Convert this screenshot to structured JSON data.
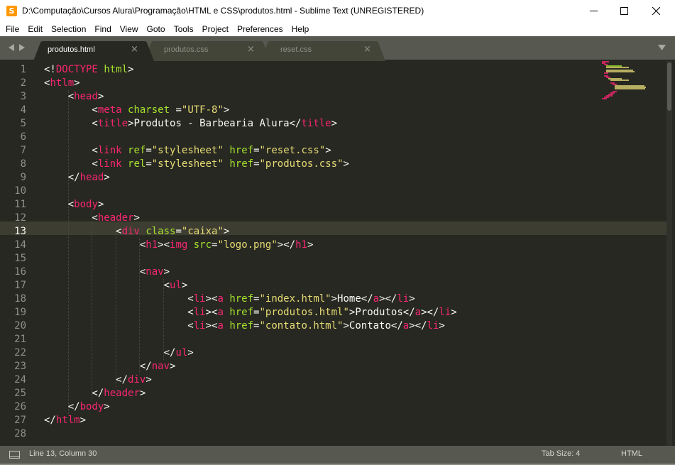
{
  "window": {
    "title": "D:\\Computação\\Cursos Alura\\Programação\\HTML e CSS\\produtos.html - Sublime Text (UNREGISTERED)",
    "app_icon_letter": "S"
  },
  "menu": [
    "File",
    "Edit",
    "Selection",
    "Find",
    "View",
    "Goto",
    "Tools",
    "Project",
    "Preferences",
    "Help"
  ],
  "tabs": [
    {
      "label": "produtos.html",
      "active": true
    },
    {
      "label": "produtos.css",
      "active": false
    },
    {
      "label": "reset.css",
      "active": false
    }
  ],
  "editor": {
    "current_line": 13,
    "line_numbers": [
      "1",
      "2",
      "3",
      "4",
      "5",
      "6",
      "7",
      "8",
      "9",
      "10",
      "11",
      "12",
      "13",
      "14",
      "15",
      "16",
      "17",
      "18",
      "19",
      "20",
      "21",
      "22",
      "23",
      "24",
      "25",
      "26",
      "27",
      "28"
    ],
    "lines": [
      [
        [
          "t",
          "<!"
        ],
        [
          "k",
          "DOCTYPE"
        ],
        [
          "t",
          " "
        ],
        [
          "a",
          "html"
        ],
        [
          "t",
          ">"
        ]
      ],
      [
        [
          "t",
          "<"
        ],
        [
          "k",
          "htlm"
        ],
        [
          "t",
          ">"
        ]
      ],
      [
        [
          "t",
          "    <"
        ],
        [
          "k",
          "head"
        ],
        [
          "t",
          ">"
        ]
      ],
      [
        [
          "t",
          "        <"
        ],
        [
          "k",
          "meta"
        ],
        [
          "t",
          " "
        ],
        [
          "a",
          "charset"
        ],
        [
          "t",
          " ="
        ],
        [
          "s",
          "\"UTF-8\""
        ],
        [
          "t",
          ">"
        ]
      ],
      [
        [
          "t",
          "        <"
        ],
        [
          "k",
          "title"
        ],
        [
          "t",
          ">Produtos - Barbearia Alura</"
        ],
        [
          "k",
          "title"
        ],
        [
          "t",
          ">"
        ]
      ],
      [],
      [
        [
          "t",
          "        <"
        ],
        [
          "k",
          "link"
        ],
        [
          "t",
          " "
        ],
        [
          "a",
          "ref"
        ],
        [
          "t",
          "="
        ],
        [
          "s",
          "\"stylesheet\""
        ],
        [
          "t",
          " "
        ],
        [
          "a",
          "href"
        ],
        [
          "t",
          "="
        ],
        [
          "s",
          "\"reset.css\""
        ],
        [
          "t",
          ">"
        ]
      ],
      [
        [
          "t",
          "        <"
        ],
        [
          "k",
          "link"
        ],
        [
          "t",
          " "
        ],
        [
          "a",
          "rel"
        ],
        [
          "t",
          "="
        ],
        [
          "s",
          "\"stylesheet\""
        ],
        [
          "t",
          " "
        ],
        [
          "a",
          "href"
        ],
        [
          "t",
          "="
        ],
        [
          "s",
          "\"produtos.css\""
        ],
        [
          "t",
          ">"
        ]
      ],
      [
        [
          "t",
          "    </"
        ],
        [
          "k",
          "head"
        ],
        [
          "t",
          ">"
        ]
      ],
      [],
      [
        [
          "t",
          "    <"
        ],
        [
          "k",
          "body"
        ],
        [
          "t",
          ">"
        ]
      ],
      [
        [
          "t",
          "        <"
        ],
        [
          "k",
          "header"
        ],
        [
          "t",
          ">"
        ]
      ],
      [
        [
          "t",
          "            <"
        ],
        [
          "k",
          "div"
        ],
        [
          "t",
          " "
        ],
        [
          "a",
          "class"
        ],
        [
          "t",
          "="
        ],
        [
          "s",
          "\"caixa\""
        ],
        [
          "t",
          ">"
        ]
      ],
      [
        [
          "t",
          "                <"
        ],
        [
          "k",
          "h1"
        ],
        [
          "t",
          "><"
        ],
        [
          "k",
          "img"
        ],
        [
          "t",
          " "
        ],
        [
          "a",
          "src"
        ],
        [
          "t",
          "="
        ],
        [
          "s",
          "\"logo.png\""
        ],
        [
          "t",
          "></"
        ],
        [
          "k",
          "h1"
        ],
        [
          "t",
          ">"
        ]
      ],
      [],
      [
        [
          "t",
          "                <"
        ],
        [
          "k",
          "nav"
        ],
        [
          "t",
          ">"
        ]
      ],
      [
        [
          "t",
          "                    <"
        ],
        [
          "k",
          "ul"
        ],
        [
          "t",
          ">"
        ]
      ],
      [
        [
          "t",
          "                        <"
        ],
        [
          "k",
          "li"
        ],
        [
          "t",
          "><"
        ],
        [
          "k",
          "a"
        ],
        [
          "t",
          " "
        ],
        [
          "a",
          "href"
        ],
        [
          "t",
          "="
        ],
        [
          "s",
          "\"index.html\""
        ],
        [
          "t",
          ">Home</"
        ],
        [
          "k",
          "a"
        ],
        [
          "t",
          "></"
        ],
        [
          "k",
          "li"
        ],
        [
          "t",
          ">"
        ]
      ],
      [
        [
          "t",
          "                        <"
        ],
        [
          "k",
          "li"
        ],
        [
          "t",
          "><"
        ],
        [
          "k",
          "a"
        ],
        [
          "t",
          " "
        ],
        [
          "a",
          "href"
        ],
        [
          "t",
          "="
        ],
        [
          "s",
          "\"produtos.html\""
        ],
        [
          "t",
          ">Produtos</"
        ],
        [
          "k",
          "a"
        ],
        [
          "t",
          "></"
        ],
        [
          "k",
          "li"
        ],
        [
          "t",
          ">"
        ]
      ],
      [
        [
          "t",
          "                        <"
        ],
        [
          "k",
          "li"
        ],
        [
          "t",
          "><"
        ],
        [
          "k",
          "a"
        ],
        [
          "t",
          " "
        ],
        [
          "a",
          "href"
        ],
        [
          "t",
          "="
        ],
        [
          "s",
          "\"contato.html\""
        ],
        [
          "t",
          ">Contato</"
        ],
        [
          "k",
          "a"
        ],
        [
          "t",
          "></"
        ],
        [
          "k",
          "li"
        ],
        [
          "t",
          ">"
        ]
      ],
      [],
      [
        [
          "t",
          "                    </"
        ],
        [
          "k",
          "ul"
        ],
        [
          "t",
          ">"
        ]
      ],
      [
        [
          "t",
          "                </"
        ],
        [
          "k",
          "nav"
        ],
        [
          "t",
          ">"
        ]
      ],
      [
        [
          "t",
          "            </"
        ],
        [
          "k",
          "div"
        ],
        [
          "t",
          ">"
        ]
      ],
      [
        [
          "t",
          "        </"
        ],
        [
          "k",
          "header"
        ],
        [
          "t",
          ">"
        ]
      ],
      [
        [
          "t",
          "    </"
        ],
        [
          "k",
          "body"
        ],
        [
          "t",
          ">"
        ]
      ],
      [
        [
          "t",
          "</"
        ],
        [
          "k",
          "htlm"
        ],
        [
          "t",
          ">"
        ]
      ],
      []
    ]
  },
  "status": {
    "position": "Line 13, Column 30",
    "tab_size": "Tab Size: 4",
    "syntax": "HTML"
  },
  "colors": {
    "background": "#272822",
    "tag": "#f92672",
    "attribute": "#a6e22e",
    "string": "#e6db74",
    "text": "#f8f8f2",
    "line_number": "#90908a",
    "chrome": "#57584f"
  }
}
